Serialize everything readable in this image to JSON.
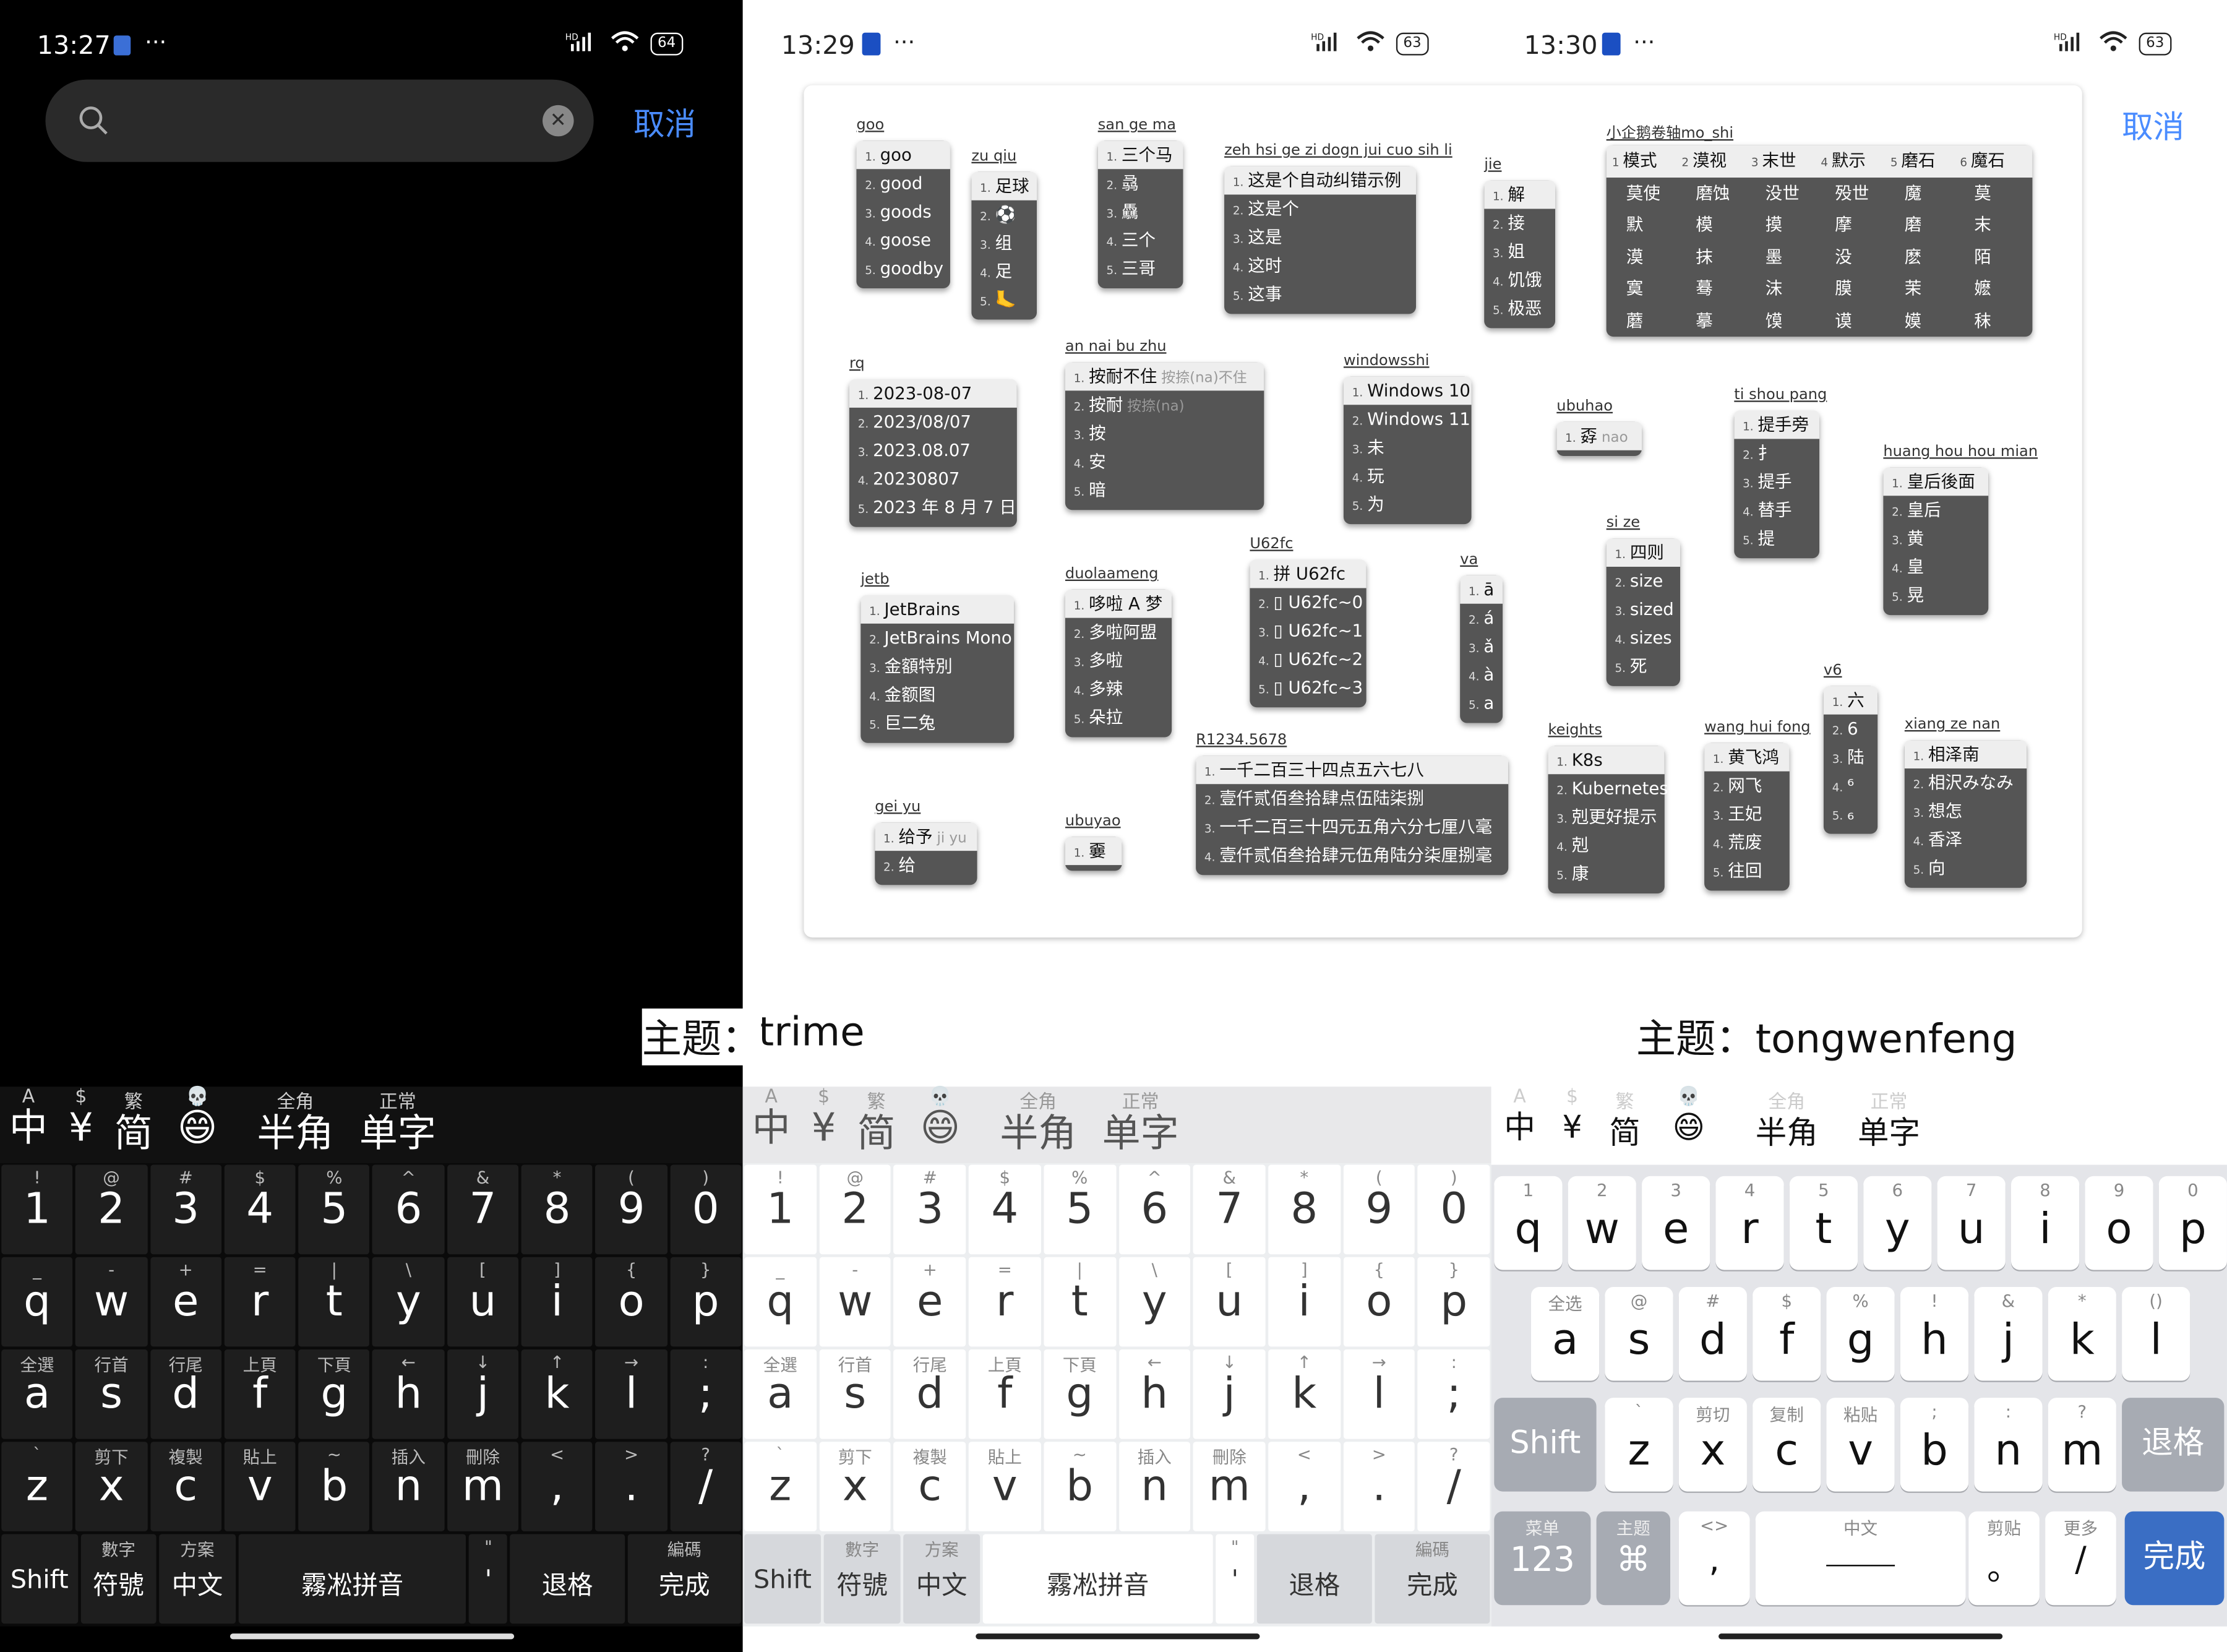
{
  "panels": {
    "left": {
      "time": "13:27",
      "battery": "64",
      "search_placeholder": "",
      "cancel": "取消",
      "caption": "主题：",
      "theme_name": "trime"
    },
    "middle": {
      "time": "13:29",
      "battery": "63",
      "theme_name": "trime"
    },
    "right": {
      "time": "13:30",
      "battery": "63",
      "cancel": "取消",
      "caption": "主题：tongwenfeng"
    }
  },
  "status_signal": "HD",
  "icons": {
    "more": "···",
    "search": "search-icon",
    "clear": "clear-icon",
    "wifi": "wifi-icon",
    "signal": "signal-icon"
  },
  "candidate_bar": [
    {
      "top": "A",
      "bottom": "中"
    },
    {
      "top": "$",
      "bottom": "¥"
    },
    {
      "top": "繁",
      "bottom": "简"
    },
    {
      "top": "💀",
      "bottom": "😄"
    },
    {
      "top": "全角",
      "bottom": "半角"
    },
    {
      "top": "正常",
      "bottom": "单字"
    }
  ],
  "trime_keyboard": {
    "row_numbers": [
      {
        "hint": "!",
        "main": "1"
      },
      {
        "hint": "@",
        "main": "2"
      },
      {
        "hint": "#",
        "main": "3"
      },
      {
        "hint": "$",
        "main": "4"
      },
      {
        "hint": "%",
        "main": "5"
      },
      {
        "hint": "^",
        "main": "6"
      },
      {
        "hint": "&",
        "main": "7"
      },
      {
        "hint": "*",
        "main": "8"
      },
      {
        "hint": "(",
        "main": "9"
      },
      {
        "hint": ")",
        "main": "0"
      }
    ],
    "row_q": [
      {
        "hint": "_",
        "main": "q"
      },
      {
        "hint": "-",
        "main": "w"
      },
      {
        "hint": "+",
        "main": "e"
      },
      {
        "hint": "=",
        "main": "r"
      },
      {
        "hint": "|",
        "main": "t"
      },
      {
        "hint": "\\",
        "main": "y"
      },
      {
        "hint": "[",
        "main": "u"
      },
      {
        "hint": "]",
        "main": "i"
      },
      {
        "hint": "{",
        "main": "o"
      },
      {
        "hint": "}",
        "main": "p"
      }
    ],
    "row_a": [
      {
        "hint": "全選",
        "main": "a"
      },
      {
        "hint": "行首",
        "main": "s"
      },
      {
        "hint": "行尾",
        "main": "d"
      },
      {
        "hint": "上頁",
        "main": "f"
      },
      {
        "hint": "下頁",
        "main": "g"
      },
      {
        "hint": "←",
        "main": "h"
      },
      {
        "hint": "↓",
        "main": "j"
      },
      {
        "hint": "↑",
        "main": "k"
      },
      {
        "hint": "→",
        "main": "l"
      },
      {
        "hint": ":",
        "main": ";"
      }
    ],
    "row_z": [
      {
        "hint": "`",
        "main": "z"
      },
      {
        "hint": "剪下",
        "main": "x"
      },
      {
        "hint": "複製",
        "main": "c"
      },
      {
        "hint": "貼上",
        "main": "v"
      },
      {
        "hint": "~",
        "main": "b"
      },
      {
        "hint": "插入",
        "main": "n"
      },
      {
        "hint": "刪除",
        "main": "m"
      },
      {
        "hint": "<",
        "main": ","
      },
      {
        "hint": ">",
        "main": "."
      },
      {
        "hint": "?",
        "main": "/"
      }
    ],
    "row_bottom": [
      {
        "hint": "",
        "main": "Shift",
        "w": 1
      },
      {
        "hint": "數字",
        "main": "符號",
        "w": 1
      },
      {
        "hint": "方案",
        "main": "中文",
        "w": 1
      },
      {
        "hint": "",
        "main": "霧凇拼音",
        "w": 3
      },
      {
        "hint": "\"",
        "main": "'",
        "w": 0.5
      },
      {
        "hint": "",
        "main": "退格",
        "w": 1.5
      },
      {
        "hint": "編碼",
        "main": "完成",
        "w": 1.5
      }
    ]
  },
  "tongwenfeng_keyboard": {
    "row_q": [
      {
        "hint": "1",
        "main": "q"
      },
      {
        "hint": "2",
        "main": "w"
      },
      {
        "hint": "3",
        "main": "e"
      },
      {
        "hint": "4",
        "main": "r"
      },
      {
        "hint": "5",
        "main": "t"
      },
      {
        "hint": "6",
        "main": "y"
      },
      {
        "hint": "7",
        "main": "u"
      },
      {
        "hint": "8",
        "main": "i"
      },
      {
        "hint": "9",
        "main": "o"
      },
      {
        "hint": "0",
        "main": "p"
      }
    ],
    "row_a": [
      {
        "hint": "全选",
        "main": "a"
      },
      {
        "hint": "@",
        "main": "s"
      },
      {
        "hint": "#",
        "main": "d"
      },
      {
        "hint": "$",
        "main": "f"
      },
      {
        "hint": "%",
        "main": "g"
      },
      {
        "hint": "!",
        "main": "h"
      },
      {
        "hint": "&",
        "main": "j"
      },
      {
        "hint": "*",
        "main": "k"
      },
      {
        "hint": "()",
        "main": "l"
      }
    ],
    "row_z": [
      {
        "hint": "`",
        "main": "z"
      },
      {
        "hint": "剪切",
        "main": "x"
      },
      {
        "hint": "复制",
        "main": "c"
      },
      {
        "hint": "粘贴",
        "main": "v"
      },
      {
        "hint": ";",
        "main": "b"
      },
      {
        "hint": ":",
        "main": "n"
      },
      {
        "hint": "?",
        "main": "m"
      }
    ],
    "shift": "Shift",
    "backspace": "退格",
    "bottom": [
      {
        "hint": "菜单",
        "main": "123"
      },
      {
        "hint": "主题",
        "main": "⌘"
      },
      {
        "hint": "<>",
        "main": ","
      },
      {
        "hint": "中文",
        "main": "______"
      },
      {
        "hint": "剪贴",
        "main": "。"
      },
      {
        "hint": "更多",
        "main": "/"
      }
    ],
    "done": "完成"
  },
  "preview": {
    "panes": [
      {
        "code": "goo",
        "rows": [
          "goo",
          "good",
          "goods",
          "goose",
          "goodby"
        ]
      },
      {
        "code": "zu qiu",
        "rows": [
          "足球",
          "⚽",
          "组",
          "足",
          "🦶"
        ]
      },
      {
        "code": "san ge ma",
        "rows": [
          "三个马",
          "骉",
          "驫",
          "三个",
          "三哥"
        ]
      },
      {
        "code": "zeh hsi ge zi dogn jui cuo sih li",
        "rows": [
          "这是个自动纠错示例",
          "这是个",
          "这是",
          "这时",
          "这事"
        ]
      },
      {
        "code": "jie",
        "rows": [
          "解",
          "接",
          "姐",
          "饥饿",
          "极恶"
        ]
      },
      {
        "code": "rq",
        "rows": [
          "2023-08-07",
          "2023/08/07",
          "2023.08.07",
          "20230807",
          "2023 年 8 月 7 日"
        ]
      },
      {
        "code": "an nai bu zhu",
        "rows": [
          "按耐不住",
          "按耐",
          "按",
          "安",
          "暗"
        ],
        "comments": [
          "按捺(na)不住",
          "按捺(na)",
          "",
          "",
          ""
        ]
      },
      {
        "code": "windowsshi",
        "rows": [
          "Windows 10",
          "Windows 11",
          "未",
          "玩",
          "为"
        ]
      },
      {
        "code": "ubuhao",
        "rows": [
          "孬"
        ],
        "comments": [
          "nao"
        ]
      },
      {
        "code": "ti shou pang",
        "rows": [
          "提手旁",
          "扌",
          "提手",
          "替手",
          "提"
        ]
      },
      {
        "code": "huang hou hou mian",
        "rows": [
          "皇后後面",
          "皇后",
          "黄",
          "皇",
          "晃"
        ]
      },
      {
        "code": "jetb",
        "rows": [
          "JetBrains",
          "JetBrains Mono",
          "金額特別",
          "金额图",
          "巨二兔"
        ]
      },
      {
        "code": "duolaameng",
        "rows": [
          "哆啦 A 梦",
          "多啦阿盟",
          "多啦",
          "多辣",
          "朵拉"
        ]
      },
      {
        "code": "U62fc",
        "rows": [
          "拼 U62fc",
          "▯ U62fc~0",
          "▯ U62fc~1",
          "▯ U62fc~2",
          "▯ U62fc~3"
        ]
      },
      {
        "code": "va",
        "rows": [
          "ā",
          "á",
          "ǎ",
          "à",
          "a"
        ]
      },
      {
        "code": "si ze",
        "rows": [
          "四则",
          "size",
          "sized",
          "sizes",
          "死"
        ]
      },
      {
        "code": "v6",
        "rows": [
          "六",
          "6",
          "陆",
          "⁶",
          "₆"
        ]
      },
      {
        "code": "R1234.5678",
        "rows": [
          "一千二百三十四点五六七八",
          "壹仟贰佰叁拾肆点伍陆柒捌",
          "一千二百三十四元五角六分七厘八毫",
          "壹仟贰佰叁拾肆元伍角陆分柒厘捌毫"
        ]
      },
      {
        "code": "keights",
        "rows": [
          "K8s",
          "Kubernetes",
          "剋更好提示",
          "剋",
          "康"
        ]
      },
      {
        "code": "wang hui fong",
        "rows": [
          "黄飞鸿",
          "网飞",
          "王妃",
          "荒废",
          "往回"
        ]
      },
      {
        "code": "xiang ze nan",
        "rows": [
          "相泽南",
          "相沢みなみ",
          "想怎",
          "香泽",
          "向"
        ]
      },
      {
        "code": "gei yu",
        "rows": [
          "给予",
          "给"
        ],
        "comments": [
          "ji yu",
          ""
        ]
      },
      {
        "code": "ubuyao",
        "rows": [
          "嫑"
        ]
      }
    ],
    "grid_code": "小企鹅卷轴mo_shi",
    "grid_header": [
      "模式",
      "漠视",
      "末世",
      "默示",
      "磨石",
      "魔石"
    ],
    "grid_rows": [
      [
        "莫使",
        "磨蚀",
        "没世",
        "殁世",
        "魔",
        "莫"
      ],
      [
        "默",
        "模",
        "摸",
        "摩",
        "磨",
        "末"
      ],
      [
        "漠",
        "抹",
        "墨",
        "没",
        "麽",
        "陌"
      ],
      [
        "寞",
        "蓦",
        "沫",
        "膜",
        "茉",
        "嬷"
      ],
      [
        "蘑",
        "摹",
        "馍",
        "谟",
        "嫫",
        "秣"
      ]
    ]
  }
}
